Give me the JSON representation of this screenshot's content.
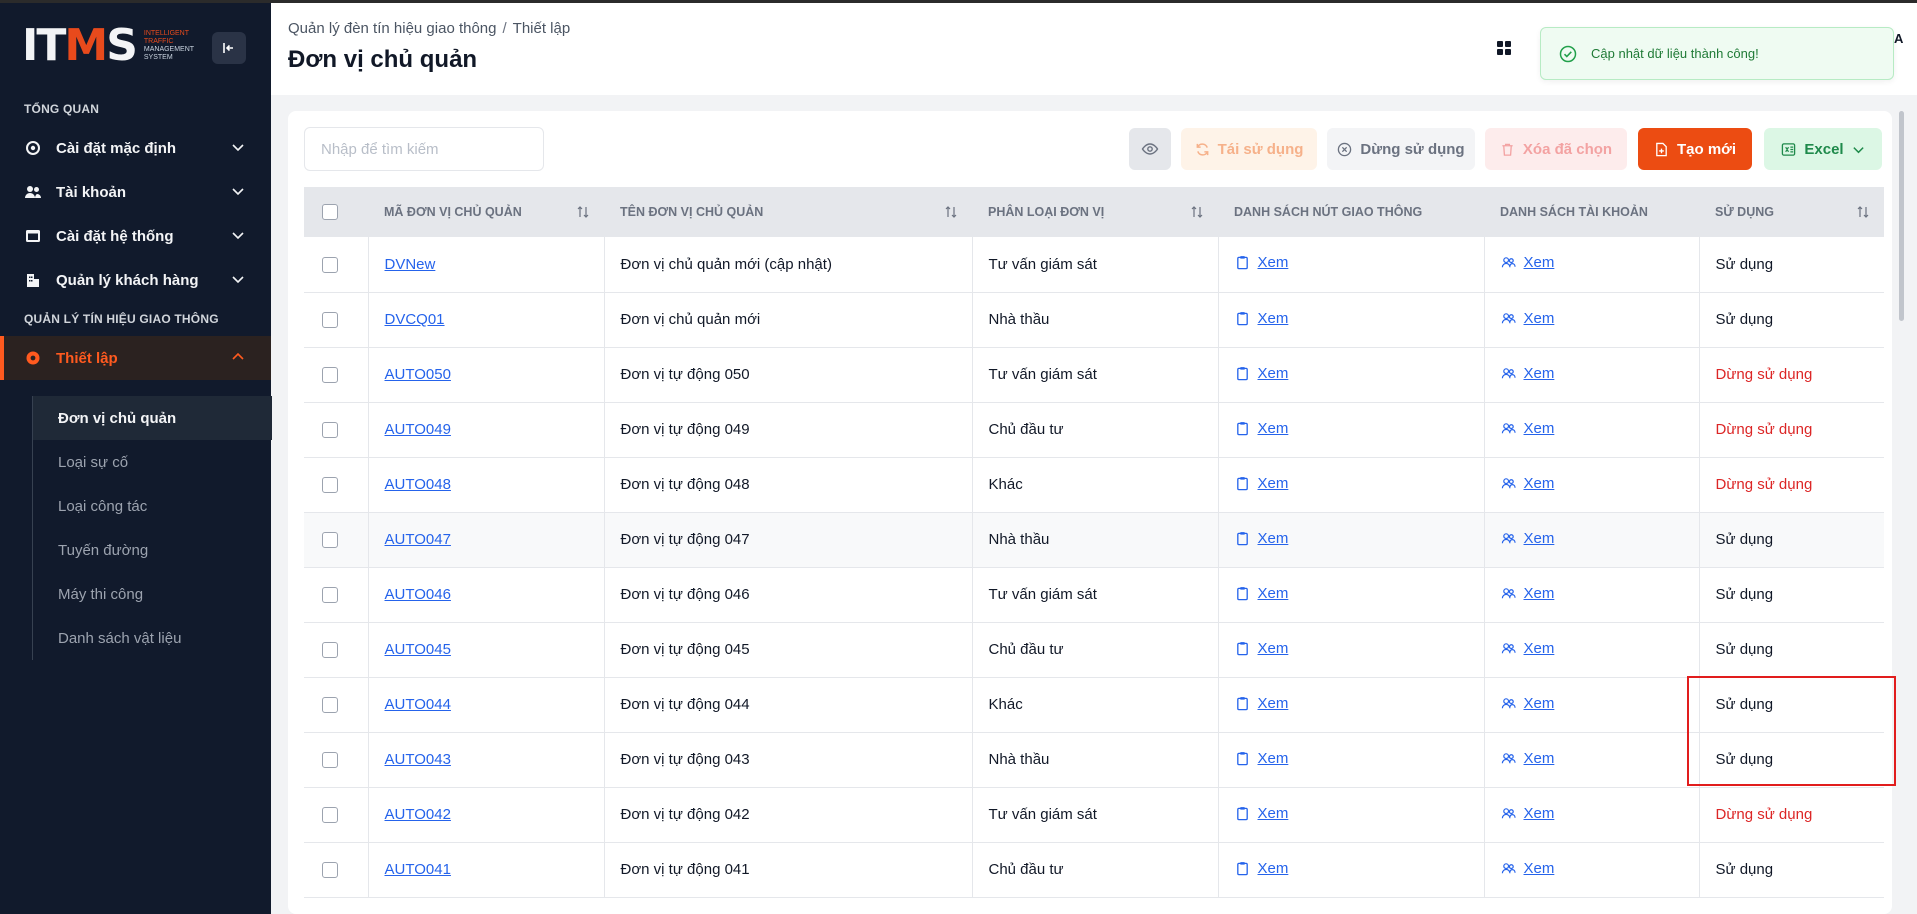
{
  "brand": {
    "logo": "ITMS",
    "tagline_lines": [
      "INTELLIGENT",
      "TRAFFIC",
      "MANAGEMENT",
      "SYSTEM"
    ]
  },
  "sidebar": {
    "section_overview": "TỔNG QUAN",
    "items": [
      {
        "label": "Cài đặt mặc định",
        "icon": "gear-icon"
      },
      {
        "label": "Tài khoản",
        "icon": "users-icon"
      },
      {
        "label": "Cài đặt hệ thống",
        "icon": "window-icon"
      },
      {
        "label": "Quản lý khách hàng",
        "icon": "building-icon"
      }
    ],
    "section_signals": "QUẢN LÝ TÍN HIỆU GIAO THÔNG",
    "active_item": {
      "label": "Thiết lập",
      "icon": "settings-icon"
    },
    "sub_items": [
      {
        "label": "Đơn vị chủ quản"
      },
      {
        "label": "Loại sự cố"
      },
      {
        "label": "Loại công tác"
      },
      {
        "label": "Tuyến đường"
      },
      {
        "label": "Máy thi công"
      },
      {
        "label": "Danh sách vật liệu"
      }
    ]
  },
  "header": {
    "breadcrumb": [
      "Quản lý đèn tín hiệu giao thông",
      "Thiết lập"
    ],
    "breadcrumb_sep": "/",
    "title": "Đơn vị chủ quản",
    "user_initial": "A"
  },
  "toast": {
    "message": "Cập nhật dữ liệu thành công!"
  },
  "toolbar": {
    "search_placeholder": "Nhập để tìm kiếm",
    "reuse_label": "Tái sử dụng",
    "stop_label": "Dừng sử dụng",
    "delete_label": "Xóa đã chọn",
    "create_label": "Tạo mới",
    "excel_label": "Excel"
  },
  "table": {
    "columns": [
      "MÃ ĐƠN VỊ CHỦ QUẢN",
      "TÊN ĐƠN VỊ CHỦ QUẢN",
      "PHÂN LOẠI ĐƠN VỊ",
      "DANH SÁCH NÚT GIAO THÔNG",
      "DANH SÁCH TÀI KHOẢN",
      "SỬ DỤNG"
    ],
    "rows": [
      {
        "code": "DVNew",
        "name": "Đơn vị chủ quản mới (cập nhật)",
        "type": "Tư vấn giám sát",
        "nodes": "Xem",
        "accounts": "Xem",
        "status": "Sử dụng",
        "active": true
      },
      {
        "code": "DVCQ01",
        "name": "Đơn vị chủ quản mới",
        "type": "Nhà thầu",
        "nodes": "Xem",
        "accounts": "Xem",
        "status": "Sử dụng",
        "active": true
      },
      {
        "code": "AUTO050",
        "name": "Đơn vị tự động 050",
        "type": "Tư vấn giám sát",
        "nodes": "Xem",
        "accounts": "Xem",
        "status": "Dừng sử dụng",
        "active": false
      },
      {
        "code": "AUTO049",
        "name": "Đơn vị tự động 049",
        "type": "Chủ đầu tư",
        "nodes": "Xem",
        "accounts": "Xem",
        "status": "Dừng sử dụng",
        "active": false
      },
      {
        "code": "AUTO048",
        "name": "Đơn vị tự động 048",
        "type": "Khác",
        "nodes": "Xem",
        "accounts": "Xem",
        "status": "Dừng sử dụng",
        "active": false
      },
      {
        "code": "AUTO047",
        "name": "Đơn vị tự động 047",
        "type": "Nhà thầu",
        "nodes": "Xem",
        "accounts": "Xem",
        "status": "Sử dụng",
        "active": true
      },
      {
        "code": "AUTO046",
        "name": "Đơn vị tự động 046",
        "type": "Tư vấn giám sát",
        "nodes": "Xem",
        "accounts": "Xem",
        "status": "Sử dụng",
        "active": true
      },
      {
        "code": "AUTO045",
        "name": "Đơn vị tự động 045",
        "type": "Chủ đầu tư",
        "nodes": "Xem",
        "accounts": "Xem",
        "status": "Sử dụng",
        "active": true
      },
      {
        "code": "AUTO044",
        "name": "Đơn vị tự động 044",
        "type": "Khác",
        "nodes": "Xem",
        "accounts": "Xem",
        "status": "Sử dụng",
        "active": true
      },
      {
        "code": "AUTO043",
        "name": "Đơn vị tự động 043",
        "type": "Nhà thầu",
        "nodes": "Xem",
        "accounts": "Xem",
        "status": "Sử dụng",
        "active": true
      },
      {
        "code": "AUTO042",
        "name": "Đơn vị tự động 042",
        "type": "Tư vấn giám sát",
        "nodes": "Xem",
        "accounts": "Xem",
        "status": "Dừng sử dụng",
        "active": false
      },
      {
        "code": "AUTO041",
        "name": "Đơn vị tự động 041",
        "type": "Chủ đầu tư",
        "nodes": "Xem",
        "accounts": "Xem",
        "status": "Sử dụng",
        "active": true
      }
    ]
  },
  "colors": {
    "sidebar_bg": "#111a2c",
    "accent": "#ec4c12",
    "link": "#2563eb",
    "status_off": "#dc2626",
    "toast_bg": "#effbf2"
  }
}
